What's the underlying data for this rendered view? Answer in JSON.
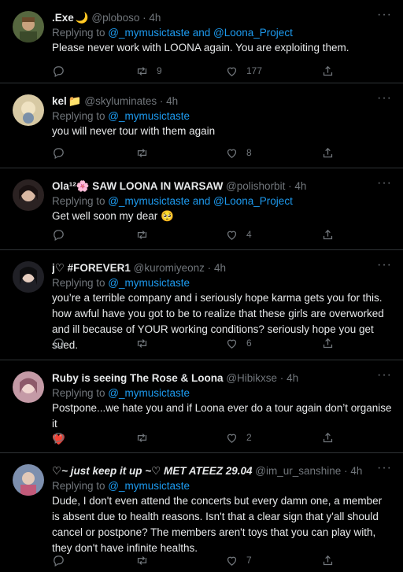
{
  "tweets": [
    {
      "name": ".Exe",
      "name_emoji": "🌙",
      "handle": "@ploboso",
      "dot": "·",
      "time": "4h",
      "replying_prefix": "Replying to ",
      "replying_targets": "@_mymusictaste and @Loona_Project",
      "text": "Please never work with LOONA again. You are exploiting them.",
      "replies": "",
      "retweets": "9",
      "likes": "177",
      "avatar_color": "#4a5d3a"
    },
    {
      "name": "kel",
      "name_emoji": "📁",
      "handle": "@skyluminates",
      "dot": "·",
      "time": "4h",
      "replying_prefix": "Replying to ",
      "replying_targets": "@_mymusictaste",
      "text": "you will never tour with them again",
      "replies": "",
      "retweets": "",
      "likes": "8",
      "avatar_color": "#c9b48a"
    },
    {
      "name": "Ola¹²🌸 SAW LOONA IN WARSAW",
      "name_emoji": "",
      "handle": "@polishorbit",
      "dot": "·",
      "time": "4h",
      "replying_prefix": "Replying to ",
      "replying_targets": "@_mymusictaste and @Loona_Project",
      "text": "Get well soon my dear 🥺",
      "replies": "",
      "retweets": "",
      "likes": "4",
      "avatar_color": "#3b2c2c"
    },
    {
      "name": "j♡ #FOREVER1",
      "name_emoji": "",
      "handle": "@kuromiyeonz",
      "dot": "·",
      "time": "4h",
      "replying_prefix": "Replying to ",
      "replying_targets": "@_mymusictaste",
      "text": "you’re a terrible company and i seriously hope karma gets you for this. how awful have you got to be to realize that these girls are overworked and ill because of YOUR working conditions? seriously hope you get sued.",
      "replies": "",
      "retweets": "",
      "likes": "6",
      "avatar_color": "#2a2a30"
    },
    {
      "name": "Ruby is seeing The Rose & Loona",
      "name_emoji": "",
      "handle": "@Hibikxse",
      "dot": "·",
      "time": "4h",
      "replying_prefix": "Replying to ",
      "replying_targets": "@_mymusictaste",
      "text": "Postpone...we hate you and if Loona ever do a tour again don’t organise it",
      "text_line2": "❤️",
      "replies": "",
      "retweets": "",
      "likes": "2",
      "avatar_color": "#b07a8a"
    },
    {
      "name": "♡~ just keep it up ~♡ MET ATEEZ 29.04",
      "name_emoji": "",
      "handle": "@im_ur_sanshine",
      "dot": "·",
      "time": "4h",
      "replying_prefix": "Replying to ",
      "replying_targets": "@_mymusictaste",
      "text": "Dude, I don't even attend the concerts but every damn one, a member is absent due to health reasons. Isn't that a clear sign that y'all should cancel or postpone? The members aren't toys that you can play with, they don't have infinite healths.",
      "replies": "",
      "retweets": "",
      "likes": "7",
      "avatar_color": "#6a7a9a"
    }
  ],
  "more_label": "···"
}
